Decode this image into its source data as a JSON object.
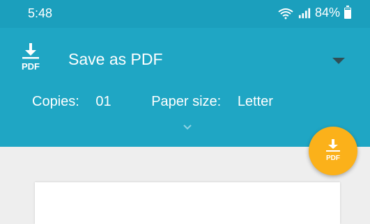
{
  "status_bar": {
    "time": "5:48",
    "battery": "84%",
    "icons": [
      "wifi-icon",
      "signal-icon",
      "battery-icon"
    ]
  },
  "header": {
    "printer_name": "Save as PDF",
    "printer_icon": "pdf-download-icon",
    "pdf_label": "PDF"
  },
  "settings": {
    "copies_label": "Copies:",
    "copies_value": "01",
    "paper_size_label": "Paper size:",
    "paper_size_value": "Letter"
  },
  "fab": {
    "icon": "pdf-download-icon",
    "label": "PDF"
  },
  "colors": {
    "header_bg": "#1fa6c4",
    "status_bg": "#1b9fbd",
    "fab_bg": "#fbb11a",
    "page_bg": "#eeeeee"
  }
}
